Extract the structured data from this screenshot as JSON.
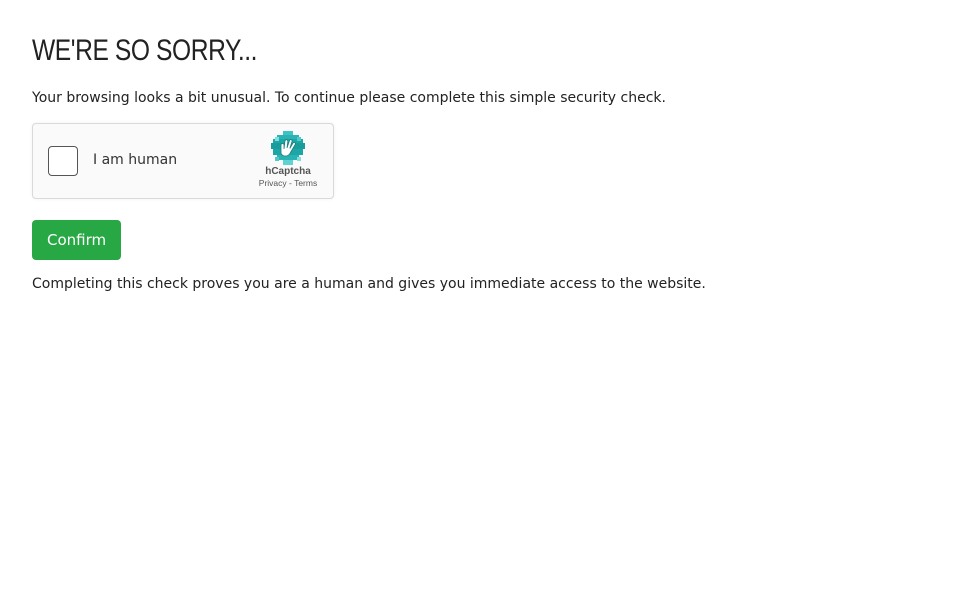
{
  "page": {
    "heading": "WE'RE SO SORRY...",
    "intro": "Your browsing looks a bit unusual. To continue please complete this simple security check.",
    "footnote": "Completing this check proves you are a human and gives you immediate access to the website."
  },
  "captcha": {
    "checkbox_label": "I am human",
    "brand_name": "hCaptcha",
    "privacy_link": "Privacy",
    "separator": " - ",
    "terms_link": "Terms",
    "logo_icon": "hcaptcha-hand-icon",
    "checked": false
  },
  "actions": {
    "confirm_label": "Confirm"
  },
  "colors": {
    "confirm_button": "#28a745",
    "captcha_logo_teal": "#1ca6a6",
    "captcha_logo_light": "#5fd3d3"
  }
}
